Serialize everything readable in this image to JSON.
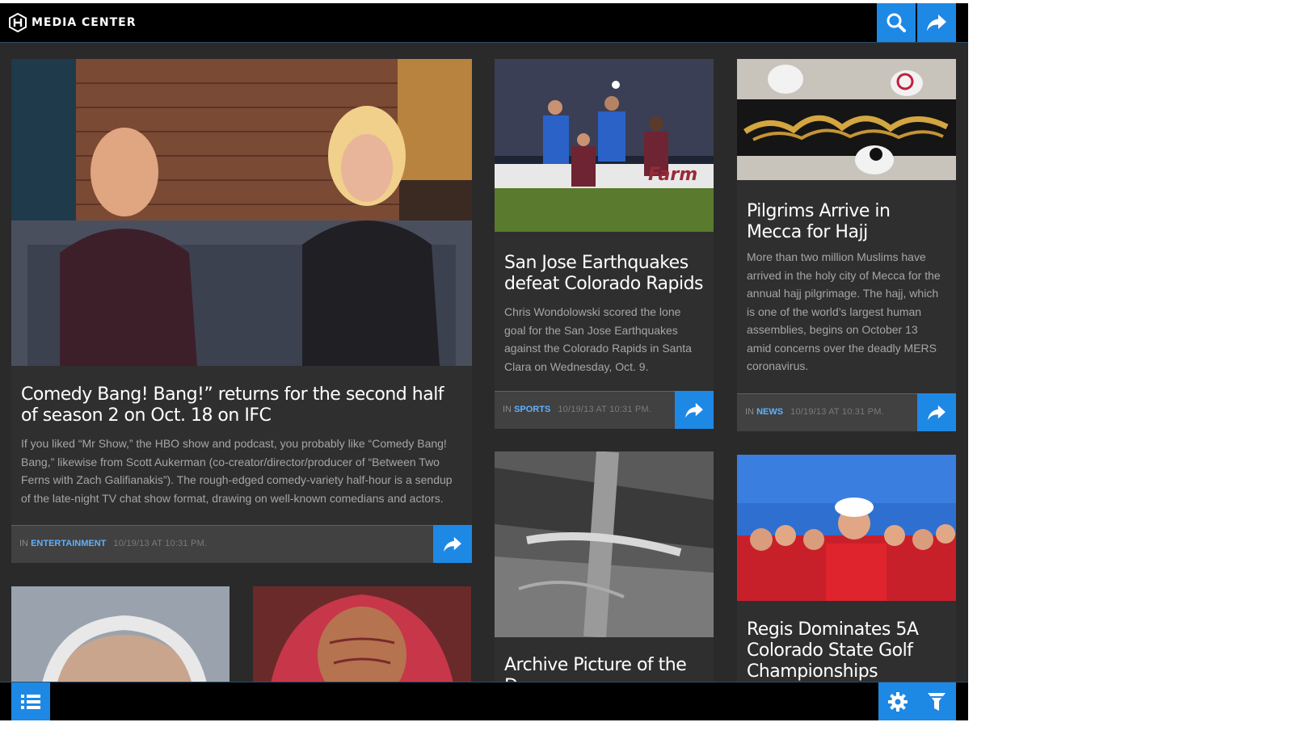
{
  "app": {
    "name": "MEDIA CENTER",
    "accent": "#1e88e5"
  },
  "header": {
    "search_icon": "search-icon",
    "share_icon": "share-icon"
  },
  "footer": {
    "menu_icon": "list-icon",
    "settings_icon": "gear-icon",
    "filter_icon": "filter-icon"
  },
  "articles": [
    {
      "title": "Comedy Bang! Bang!” returns for the second half of season 2 on Oct. 18 on IFC",
      "summary": "If you liked “Mr Show,” the HBO show and podcast, you probably like “Comedy Bang! Bang,” likewise from Scott Aukerman (co-creator/director/producer of “Between Two Ferns with Zach Galifianakis”). The rough-edged comedy-variety half-hour is a sendup of the late-night TV chat show format, drawing on well-known comedians and actors.",
      "in_label": "IN",
      "category": "ENTERTAINMENT",
      "date": "10/19/13 AT 10:31 PM."
    },
    {
      "title": "San Jose Earthquakes defeat Colorado Rapids",
      "summary": "Chris Wondolowski scored the lone goal for the San Jose Earthquakes against the Colorado Rapids in Santa Clara on Wednesday, Oct. 9.",
      "in_label": "IN",
      "category": "SPORTS",
      "date": "10/19/13 AT 10:31 PM."
    },
    {
      "title": "Pilgrims Arrive in Mecca for Hajj",
      "summary": "More than two million Muslims have arrived in the holy city of Mecca for the annual hajj pilgrimage. The hajj, which is one of the world’s largest human assemblies, begins on October 13 amid concerns over the deadly MERS coronavirus.",
      "in_label": "IN",
      "category": "NEWS",
      "date": "10/19/13 AT 10:31 PM."
    },
    {
      "title": "Archive Picture of the D"
    },
    {
      "title": "Regis Dominates 5A Colorado State Golf Championships"
    }
  ]
}
